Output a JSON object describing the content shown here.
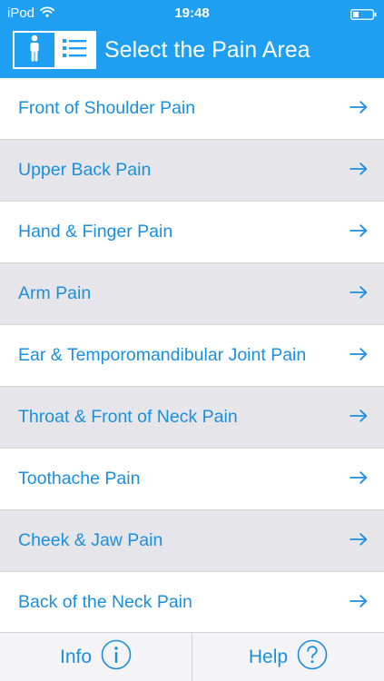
{
  "status_bar": {
    "carrier": "iPod",
    "time": "19:48",
    "wifi_icon": "wifi-icon",
    "battery_icon": "battery-icon"
  },
  "header": {
    "title": "Select the Pain Area",
    "background": "#1e9ff2",
    "toggle": {
      "options": [
        {
          "icon": "body-figure-icon",
          "selected": true
        },
        {
          "icon": "list-icon",
          "selected": false
        }
      ]
    }
  },
  "list": {
    "accent": "#1a8fde",
    "arrow_icon": "arrow-right-icon",
    "items": [
      {
        "label": "Front of Shoulder Pain"
      },
      {
        "label": "Upper Back Pain"
      },
      {
        "label": "Hand & Finger Pain"
      },
      {
        "label": "Arm Pain"
      },
      {
        "label": "Ear & Temporomandibular Joint Pain"
      },
      {
        "label": "Throat & Front of Neck Pain"
      },
      {
        "label": "Toothache Pain"
      },
      {
        "label": "Cheek & Jaw Pain"
      },
      {
        "label": "Back of the Neck Pain"
      }
    ]
  },
  "footer": {
    "info_label": "Info",
    "info_icon": "info-circle-icon",
    "help_label": "Help",
    "help_icon": "question-circle-icon"
  }
}
